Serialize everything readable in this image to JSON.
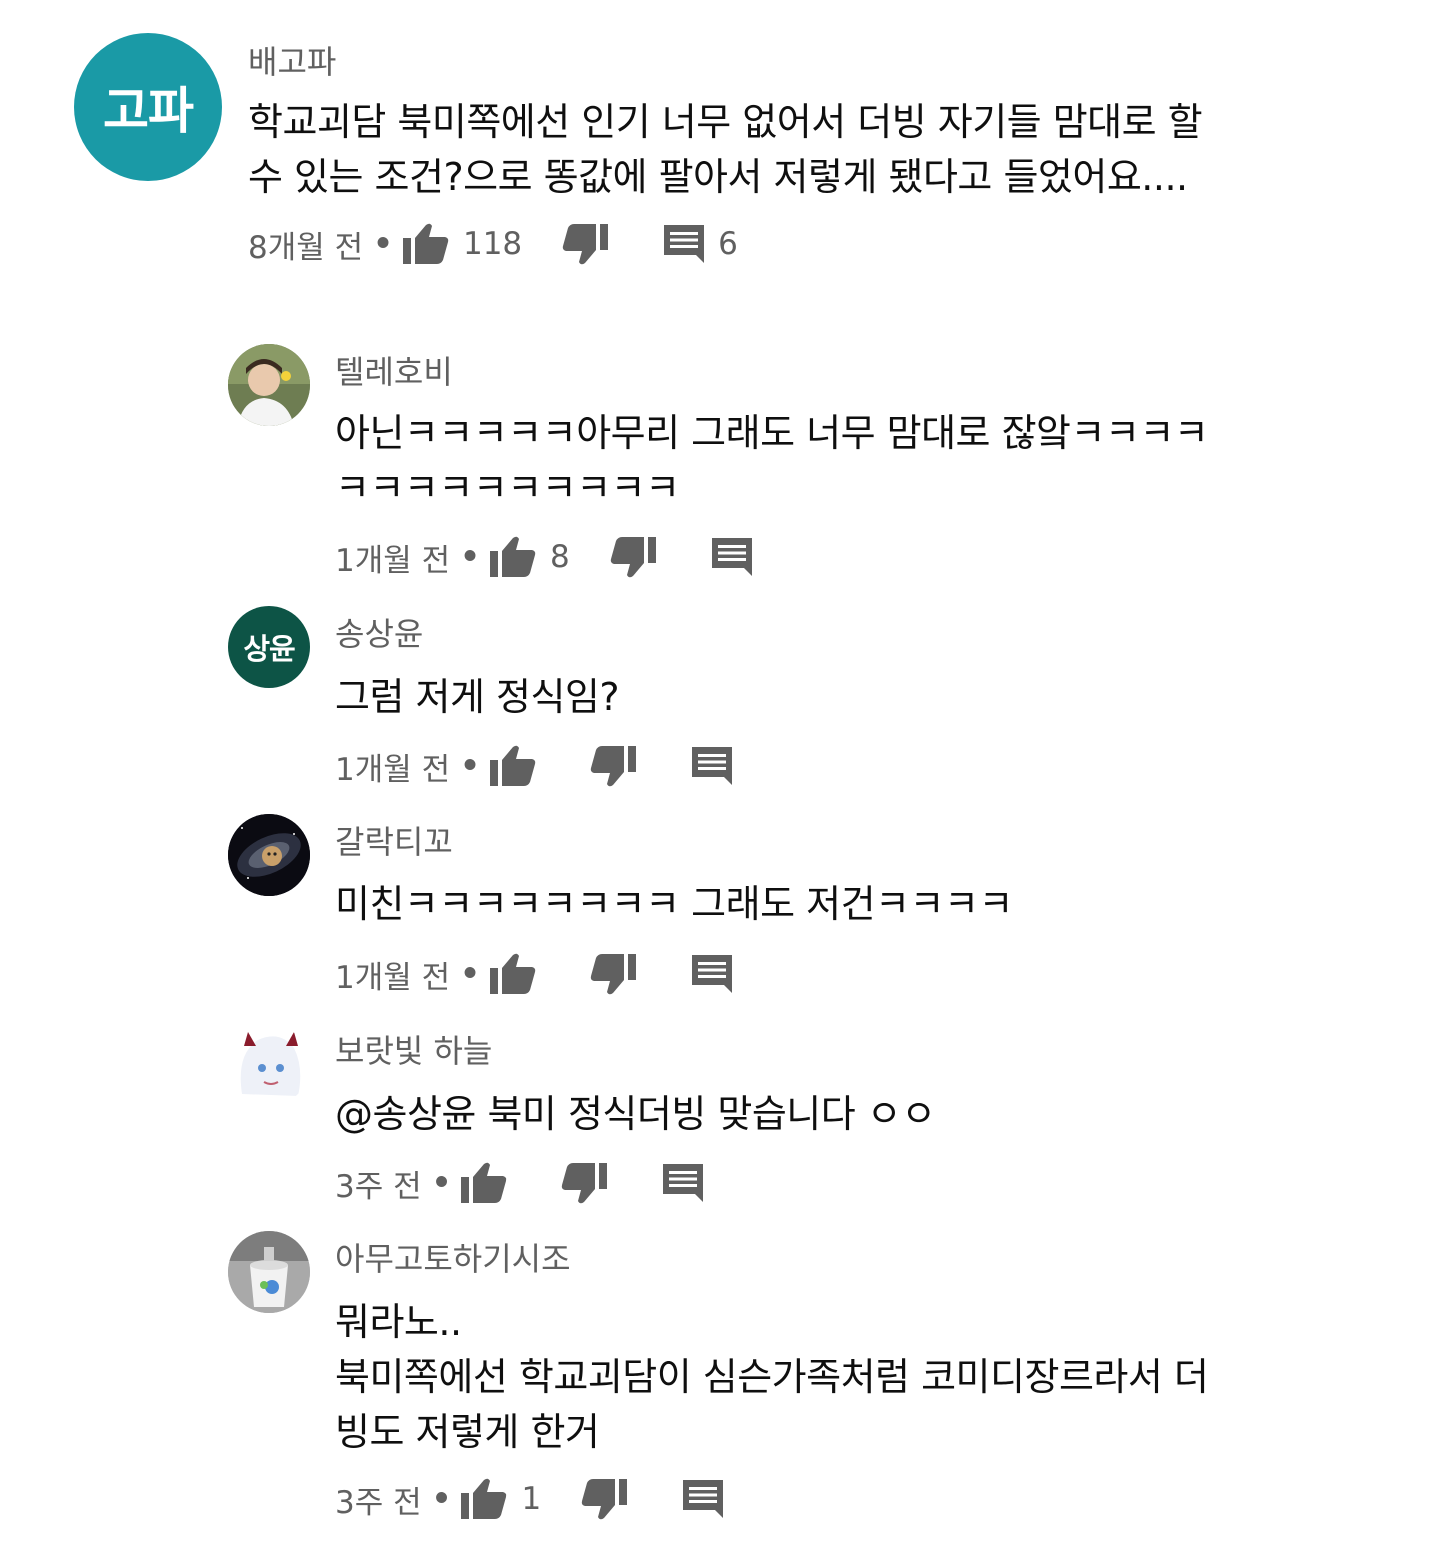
{
  "colors": {
    "text_primary": "#0f0f0f",
    "text_secondary": "#606060",
    "icon": "#606060",
    "avatar_gopa": "#1a9aa6",
    "avatar_sangyun": "#0d5446"
  },
  "comments": [
    {
      "author": "배고파",
      "avatar_text": "고파",
      "lines": [
        "학교괴담 북미쪽에선 인기 너무 없어서 더빙 자기들 맘대로 할",
        "수 있는 조건?으로 똥값에 팔아서 저렇게 됐다고 들었어요...."
      ],
      "time": "8개월 전",
      "dot": "•",
      "likes": "118",
      "replies": "6",
      "like_icon": "thumb-up-icon",
      "dislike_icon": "thumb-down-icon",
      "reply_icon": "comment-icon"
    },
    {
      "author": "텔레호비",
      "avatar_text": "",
      "lines": [
        "아닌ㅋㅋㅋㅋㅋ아무리 그래도 너무 맘대로 잖앜ㅋㅋㅋㅋ",
        "ㅋㅋㅋㅋㅋㅋㅋㅋㅋㅋ"
      ],
      "time": "1개월 전",
      "dot": "•",
      "likes": "8",
      "replies": ""
    },
    {
      "author": "송상윤",
      "avatar_text": "상윤",
      "lines": [
        "그럼 저게 정식임?"
      ],
      "time": "1개월 전",
      "dot": "•",
      "likes": "",
      "replies": ""
    },
    {
      "author": "갈락티꼬",
      "avatar_text": "",
      "lines": [
        "미친ㅋㅋㅋㅋㅋㅋㅋㅋ 그래도 저건ㅋㅋㅋㅋ"
      ],
      "time": "1개월 전",
      "dot": "•",
      "likes": "",
      "replies": ""
    },
    {
      "author": "보랏빛 하늘",
      "avatar_text": "",
      "lines": [
        "@송상윤 북미 정식더빙 맞습니다 ㅇㅇ"
      ],
      "time": "3주 전",
      "dot": "•",
      "likes": "",
      "replies": ""
    },
    {
      "author": "아무고토하기시조",
      "avatar_text": "",
      "lines": [
        "뭐라노..",
        "북미쪽에선 학교괴담이 심슨가족처럼 코미디장르라서 더",
        "빙도 저렇게 한거"
      ],
      "time": "3주 전",
      "dot": "•",
      "likes": "1",
      "replies": ""
    }
  ]
}
